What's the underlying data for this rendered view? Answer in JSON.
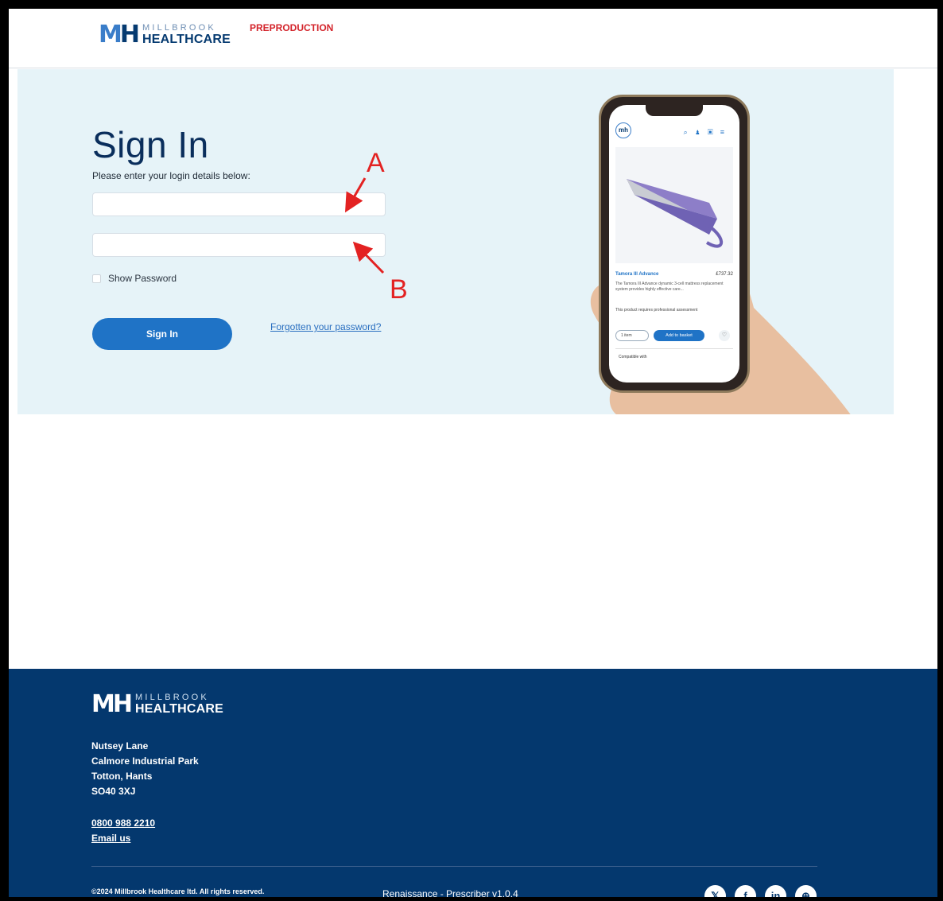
{
  "header": {
    "logo_mark_m": "M",
    "logo_mark_h": "H",
    "logo_top": "MILLBROOK",
    "logo_bottom": "HEALTHCARE",
    "environment": "PREPRODUCTION"
  },
  "signin": {
    "title": "Sign In",
    "subtitle": "Please enter your login details below:",
    "username_value": "",
    "password_value": "",
    "show_password_label": "Show Password",
    "button_label": "Sign In",
    "forgot_link": "Forgotten your password?"
  },
  "annotations": {
    "a": "A",
    "b": "B",
    "color": "#e32222"
  },
  "phone_preview": {
    "logo": "mh",
    "product_name": "Tamora III Advance",
    "price": "£737.32",
    "description": "The Tamora III Advance dynamic 3-cell mattress replacement system provides highly effective care...",
    "note": "This product requires professional assessment",
    "qty": "1 item",
    "add_button": "Add to basket",
    "compat": "Compatible with"
  },
  "footer": {
    "address": [
      "Nutsey Lane",
      "Calmore Industrial Park",
      "Totton, Hants",
      "SO40 3XJ"
    ],
    "phone": "0800 988 2210",
    "email": "Email us",
    "copyright": "©2024 Millbrook Healthcare ltd. All rights reserved.",
    "version": "Renaissance - Prescriber v1.0.4",
    "social_icons": [
      "x-icon",
      "facebook-icon",
      "linkedin-icon",
      "website-icon"
    ]
  },
  "colors": {
    "brand_navy": "#04386e",
    "brand_blue": "#1f73c6",
    "hero_bg": "#e6f3f8",
    "env_red": "#d3232a"
  }
}
